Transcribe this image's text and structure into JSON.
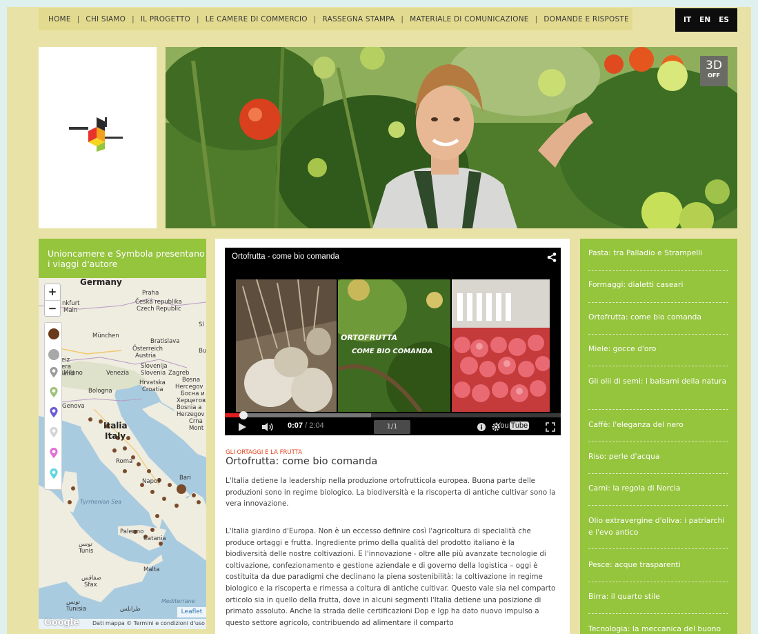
{
  "nav": {
    "items": [
      "HOME",
      "CHI SIAMO",
      "IL PROGETTO",
      "LE CAMERE DI COMMERCIO",
      "RASSEGNA STAMPA",
      "MATERIALE DI COMUNICAZIONE",
      "DOMANDE E RISPOSTE"
    ],
    "separator": "|"
  },
  "languages": [
    "IT",
    "EN",
    "ES"
  ],
  "hero": {
    "badge_top": "3D",
    "badge_bottom": "OFF"
  },
  "left_panel": {
    "title": "Unioncamere e Symbola presentano i viaggi d'autore",
    "map": {
      "zoom_in": "+",
      "zoom_out": "−",
      "labels": {
        "germany": "Germany",
        "praha": "Praha",
        "cesko1": "Česká republika",
        "cesko2": "Czech Republic",
        "frankfurt": "nkfurt",
        "main": "Main",
        "munchen": "München",
        "bratislava": "Bratislava",
        "osterreich": "Österreich",
        "austria": "Austria",
        "slovenija": "Slovenija",
        "slovenia": "Slovenia",
        "zagreb": "Zagreb",
        "milano": "Milano",
        "venezia": "Venezia",
        "hrvatska": "Hrvatska",
        "croatia": "Croatia",
        "bosna": "Bosna",
        "hercegov": "Hercegov",
        "bosna_cyr": "Босна и",
        "hercegov_cyr": "Херцегов",
        "bosnia": "Bosnia a",
        "herzegov": "Herzegov",
        "bologna": "Bologna",
        "genova": "Genova",
        "italia": "Italia",
        "italy": "Italy",
        "roma": "Roma",
        "napoli": "Napoli",
        "bari": "Bari",
        "tyrrhenian": "Tyrrhenian Sea",
        "palermo": "Palermo",
        "catania": "Catania",
        "tunis_ar": "تونس",
        "tunis": "Tunis",
        "malta": "Malta",
        "sfax_ar": "صفاقس",
        "sfax": "Sfax",
        "tunisia_ar": "تونس",
        "tunisia": "Tunisia",
        "tripoli_ar": "طرابلس",
        "mediterranean": "Mediterrane",
        "sl": "Sl",
        "bu": "Bu",
        "cr": "Crna",
        "mon": "Mont",
        "eiz": "eiz",
        "era": "era",
        "land": "land"
      },
      "leaflet": "Leaflet",
      "google": "Google",
      "attribution": "Dati mappa ©  Termini e condizioni d'uso"
    }
  },
  "video": {
    "title": "Ortofrutta - come bio comanda",
    "overlay_line1": "ORTOFRUTTA",
    "overlay_line2": "COME BIO COMANDA",
    "time_current": "0:07",
    "time_total": " / 2:04",
    "page": "1/1",
    "progress": 0.056,
    "youtube_you": "You",
    "youtube_tube": "Tube"
  },
  "article": {
    "category": "GLI ORTAGGI E LA FRUTTA",
    "title": "Ortofrutta: come bio comanda",
    "intro": "L'Italia detiene la leadership nella produzione ortofrutticola europea. Buona parte delle produzioni sono in regime biologico. La biodiversità e la riscoperta di antiche cultivar sono la vera innovazione.",
    "body": "L'Italia giardino d'Europa. Non è un eccesso definire così l'agricoltura di specialità che produce ortaggi e frutta. Ingrediente primo della qualità del prodotto italiano è la biodiversità delle nostre coltivazioni. E l'innovazione - oltre alle più avanzate tecnologie di coltivazione, confezionamento e gestione aziendale e di governo della logistica – oggi è costituita da due paradigmi che declinano la piena sostenibilità: la coltivazione in regime biologico e la riscoperta e rimessa a coltura di antiche cultivar. Questo vale sia nel comparto orticolo sia in quello della frutta, dove in alcuni segmenti l'Italia detiene una posizione di primato assoluto. Anche la strada delle certificazioni Dop e Igp ha dato nuovo impulso a questo settore agricolo, contribuendo ad alimentare il comparto"
  },
  "right_menu": [
    "Pasta: tra Palladio e Strampelli",
    "Formaggi: dialetti caseari",
    "Ortofrutta: come bio comanda",
    "Miele: gocce d'oro",
    "Gli olii di semi: i balsami della natura",
    "Caffè: l'eleganza del nero",
    "Riso: perle d'acqua",
    "Carni: la regola di Norcia",
    "Olio extravergine d'oliva: i patriarchi e l'evo antico",
    "Pesce: acque trasparenti",
    "Birra: il quarto stile",
    "Tecnologia: la meccanica del buono"
  ],
  "colors": {
    "background": "#e9e2a6",
    "nav_bg": "#e2da8e",
    "green": "#95c43d",
    "accent_red": "#e2441c"
  }
}
